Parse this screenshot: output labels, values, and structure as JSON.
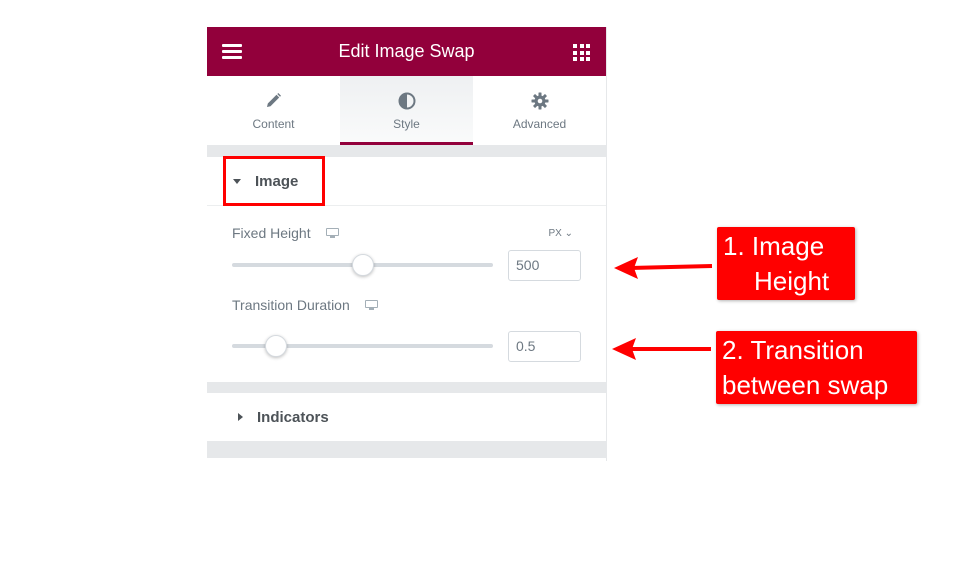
{
  "header": {
    "title": "Edit Image Swap"
  },
  "tabs": [
    {
      "label": "Content",
      "icon": "pencil-icon"
    },
    {
      "label": "Style",
      "icon": "contrast-icon",
      "active": true
    },
    {
      "label": "Advanced",
      "icon": "gear-icon"
    }
  ],
  "sections": {
    "image": {
      "title": "Image",
      "expanded": true,
      "controls": [
        {
          "label": "Fixed Height",
          "unit": "PX",
          "value": "500",
          "slider_fraction": 0.5
        },
        {
          "label": "Transition Duration",
          "value": "0.5",
          "slider_fraction": 0.17
        }
      ]
    },
    "indicators": {
      "title": "Indicators",
      "expanded": false
    }
  },
  "annotations": {
    "note1": {
      "line1": "1. Image",
      "line2": "Height"
    },
    "note2": {
      "line1": "2. Transition",
      "line2": "between swap"
    }
  },
  "colors": {
    "brand": "#92003b",
    "annotation": "#ff0000",
    "text": "#6d7882"
  }
}
